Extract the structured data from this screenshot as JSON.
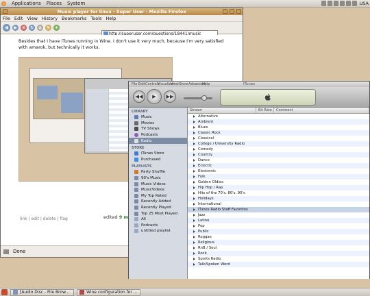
{
  "top_panel": {
    "menus": [
      "Applications",
      "Places",
      "System"
    ],
    "clock": "USA"
  },
  "firefox": {
    "title": "Music player for linux - Super User - Mozilla Firefox",
    "menus": [
      "File",
      "Edit",
      "View",
      "History",
      "Bookmarks",
      "Tools",
      "Help"
    ],
    "url": "http://superuser.com/questions/18441/music",
    "post_text": "Besides that I have iTunes running in Wine. I don't use it very much, because I'm very satisfied with amarok, but technically it works.",
    "post_menu": "link | edit | delete | flag",
    "edited_label": "edited",
    "edited_when": "9 mins",
    "status": "Done"
  },
  "itunes": {
    "title": "iTunes",
    "menu_items": [
      "File",
      "Edit",
      "Controls",
      "Visualizer",
      "View",
      "Store",
      "Advanced",
      "Help"
    ],
    "library_header": "LIBRARY",
    "library": [
      "Music",
      "Movies",
      "TV Shows",
      "Podcasts",
      "Radio"
    ],
    "store_header": "STORE",
    "store": [
      "iTunes Store",
      "Purchased"
    ],
    "playlists_header": "PLAYLISTS",
    "playlists": [
      "Party Shuffle",
      "90's Music",
      "Music Videos",
      "MusicVideos",
      "My Top Rated",
      "Recently Added",
      "Recently Played",
      "Top 25 Most Played",
      "All",
      "Podcasts",
      "untitled playlist"
    ],
    "list_headers": [
      "Stream",
      "Bit Rate",
      "Comment"
    ],
    "streams": [
      "Alternative",
      "Ambient",
      "Blues",
      "Classic Rock",
      "Classical",
      "College / University Radio",
      "Comedy",
      "Country",
      "Dance",
      "Eclectic",
      "Electronic",
      "Folk",
      "Golden Oldies",
      "Hip Hop / Rap",
      "Hits of the 70's, 80's, 90's",
      "Holidays",
      "International",
      "iTunes Radio Staff Favorites",
      "Jazz",
      "Latino",
      "Pop",
      "Public",
      "Reggae",
      "Religious",
      "RnB / Soul",
      "Rock",
      "Sports Radio",
      "Talk/Spoken Word"
    ],
    "selected_source": "Radio",
    "selected_stream": "iTunes Radio Staff Favorites"
  },
  "taskbar": {
    "tasks": [
      "[Audio Disc - File Brow...",
      "Wine configuration for ..."
    ]
  }
}
